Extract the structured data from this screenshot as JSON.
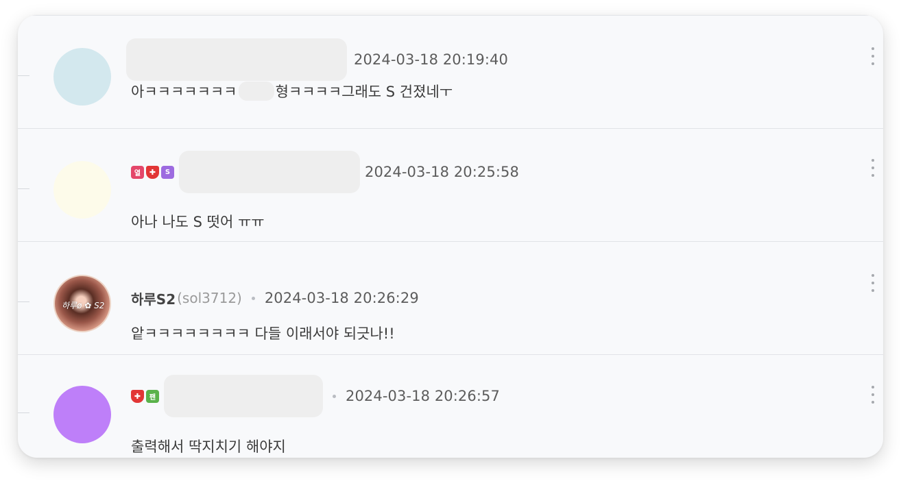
{
  "comments": [
    {
      "timestamp": "2024-03-18 20:19:40",
      "text_before": "아ㅋㅋㅋㅋㅋㅋㅋ",
      "text_after": "형ㅋㅋㅋㅋ그래도 S 건졌네ㅜ",
      "avatar_color": "#d3e8ee"
    },
    {
      "badges": [
        "열",
        "✚",
        "S"
      ],
      "timestamp": "2024-03-18 20:25:58",
      "text": "아나 나도 S 떳어 ㅠㅠ",
      "avatar_color": "#fdfbea"
    },
    {
      "nickname": "하루S2",
      "user_id": "(sol3712)",
      "avatar_text": "하루ø ✿ S2",
      "timestamp": "2024-03-18 20:26:29",
      "text": "앝ㅋㅋㅋㅋㅋㅋㅋㅋ 다들 이래서야 되긋나!!"
    },
    {
      "badges": [
        "✚",
        "팬"
      ],
      "timestamp": "2024-03-18 20:26:57",
      "text": "출력해서 딱지치기 해야지",
      "avatar_color": "#be7ff9"
    }
  ],
  "icons": {
    "more": "more-vertical-icon"
  }
}
